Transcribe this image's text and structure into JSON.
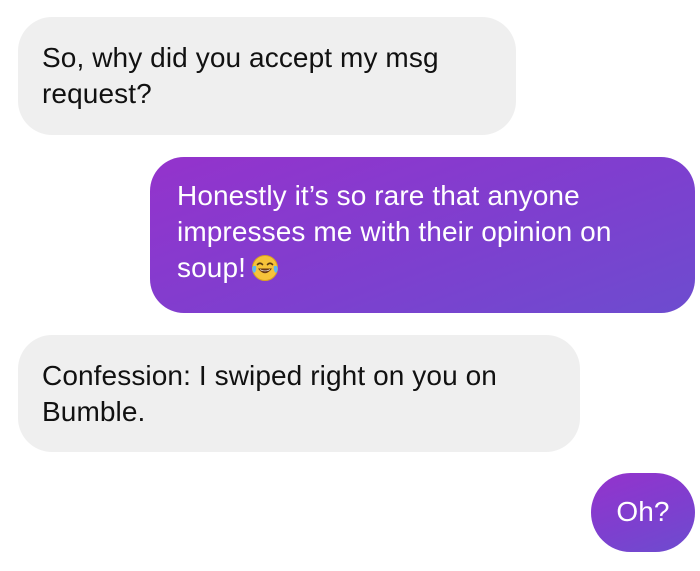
{
  "conversation": {
    "messages": [
      {
        "direction": "incoming",
        "text": "So, why did you accept my msg request?"
      },
      {
        "direction": "outgoing",
        "text": "Honestly it’s so rare that anyone impresses me with their opinion on soup!",
        "emoji": "face-with-tears-of-joy-icon"
      },
      {
        "direction": "incoming",
        "text": "Confession: I swiped right on you on Bumble."
      },
      {
        "direction": "outgoing",
        "text": "Oh?"
      }
    ]
  },
  "colors": {
    "incoming_bubble": "#efefef",
    "incoming_text": "#111111",
    "outgoing_bubble_start": "#9433cc",
    "outgoing_bubble_end": "#6d4ccf",
    "outgoing_text": "#ffffff",
    "background": "#ffffff"
  }
}
